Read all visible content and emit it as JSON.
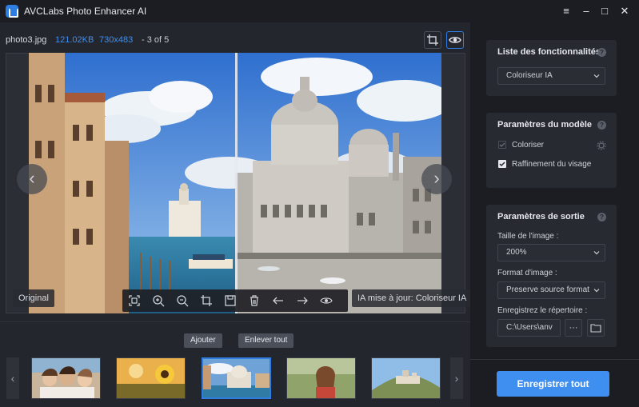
{
  "window": {
    "title": "AVCLabs Photo Enhancer AI",
    "menu_glyph": "≡",
    "minimize_glyph": "–",
    "maximize_glyph": "□",
    "close_glyph": "✕"
  },
  "file_info": {
    "name": "photo3.jpg",
    "size": "121.02KB",
    "dimensions": "730x483",
    "position": "- 3 of 5"
  },
  "preview": {
    "left_label": "Original",
    "right_label": "IA mise à jour: Coloriseur IA",
    "prev_glyph": "‹",
    "next_glyph": "›",
    "toolbar_icons": [
      "fit-screen-icon",
      "zoom-in-icon",
      "zoom-out-icon",
      "crop-icon",
      "save-icon",
      "delete-icon",
      "arrow-left-icon",
      "arrow-right-icon",
      "eye-icon"
    ]
  },
  "queue": {
    "add_label": "Ajouter",
    "remove_all_label": "Enlever tout",
    "prev_glyph": "‹",
    "next_glyph": "›",
    "thumbnails": [
      "group-photo",
      "sunflower",
      "venice-church",
      "woman-portrait",
      "hill-town"
    ],
    "selected_index": 2
  },
  "features": {
    "title": "Liste des fonctionnalités",
    "selected": "Coloriseur IA"
  },
  "model": {
    "title": "Paramètres du modèle",
    "colorize_label": "Coloriser",
    "colorize_checked": true,
    "face_label": "Raffinement du visage",
    "face_checked": true
  },
  "output": {
    "title": "Paramètres de sortie",
    "size_label": "Taille de l'image :",
    "size_value": "200%",
    "format_label": "Format d'image :",
    "format_value": "Preserve source format",
    "dir_label": "Enregistrez le répertoire :",
    "dir_value": "C:\\Users\\anv",
    "more_glyph": "···"
  },
  "save_all_label": "Enregistrer tout",
  "colors": {
    "accent": "#3f8ff0",
    "background": "#1b1d23",
    "panel": "#272a31"
  }
}
